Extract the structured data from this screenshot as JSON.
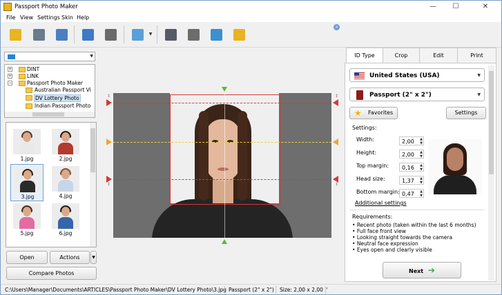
{
  "window": {
    "title": "Passport Photo Maker"
  },
  "menu": [
    "File",
    "View",
    "Settings",
    "Skin",
    "Help"
  ],
  "toolbar": {
    "buttons": [
      {
        "name": "open-folder-icon",
        "color": "#e8b422"
      },
      {
        "name": "save-icon",
        "color": "#6a7b8c"
      },
      {
        "name": "print-icon",
        "color": "#4b7fbf"
      },
      {
        "name": "user-icon",
        "color": "#3f7ac4"
      },
      {
        "name": "camera-icon",
        "color": "#6a6a6a"
      },
      {
        "name": "image-edit-icon",
        "color": "#5aa0d8"
      },
      {
        "name": "help-book-icon",
        "color": "#555a66"
      },
      {
        "name": "video-icon",
        "color": "#6c6c6c"
      },
      {
        "name": "globe-icon",
        "color": "#3d8fd0"
      },
      {
        "name": "cart-icon",
        "color": "#e8b422"
      }
    ]
  },
  "left": {
    "folder_path": "",
    "tree": [
      {
        "label": "DINT",
        "indent": 1,
        "expander": "+"
      },
      {
        "label": "LINK",
        "indent": 1,
        "expander": "+"
      },
      {
        "label": "Passport Photo Maker",
        "indent": 1,
        "expander": "−"
      },
      {
        "label": "Australian Passport Vi",
        "indent": 2,
        "expander": ""
      },
      {
        "label": "DV Lottery Photo",
        "indent": 2,
        "expander": "",
        "selected": true
      },
      {
        "label": "Indian Passport Photo",
        "indent": 2,
        "expander": ""
      }
    ],
    "photos": [
      {
        "caption": "1.jpg",
        "shirt": "#e9e9e9",
        "hair": "#5a3a24"
      },
      {
        "caption": "2.jpg",
        "shirt": "#b33a2e",
        "hair": "#2b1b12"
      },
      {
        "caption": "3.jpg",
        "shirt": "#2a2a2a",
        "hair": "#3b2418",
        "selected": true
      },
      {
        "caption": "4.jpg",
        "shirt": "#c7d6e6",
        "hair": "#7a5636"
      },
      {
        "caption": "5.jpg",
        "shirt": "#e46aa3",
        "hair": "#4a2c1a"
      },
      {
        "caption": "6.jpg",
        "shirt": "#3566a8",
        "hair": "#1c1c1c"
      }
    ],
    "open_button": "Open",
    "actions_button": "Actions",
    "compare_button": "Compare Photos"
  },
  "right": {
    "tabs": [
      "ID Type",
      "Crop",
      "Edit",
      "Print"
    ],
    "active_tab": "ID Type",
    "country": "United States (USA)",
    "document": "Passport (2\" x 2\")",
    "favorites_button": "Favorites",
    "settings_button": "Settings",
    "settings_label": "Settings:",
    "fields": [
      {
        "label": "Width:",
        "value": "2,00"
      },
      {
        "label": "Height:",
        "value": "2,00"
      },
      {
        "label": "Top margin:",
        "value": "0,16"
      },
      {
        "label": "Head size:",
        "value": "1,37"
      },
      {
        "label": "Bottom margin:",
        "value": "0,47"
      }
    ],
    "additional_settings": "Additional settings",
    "requirements_label": "Requirements:",
    "requirements": [
      "Recent photo (taken within the last 6 months)",
      "Full face front view",
      "Looking straight towards the camera",
      "Neutral face expression",
      "Eyes open and clearly visible"
    ],
    "next_button": "Next"
  },
  "status": {
    "path": "C:\\Users\\Manager\\Documents\\ARTICLES\\Passport Photo Maker\\DV Lottery Photo\\3.jpg",
    "format": "Passport (2\" x 2\")",
    "size": "Size: 2,00 x 2,00 ''"
  }
}
